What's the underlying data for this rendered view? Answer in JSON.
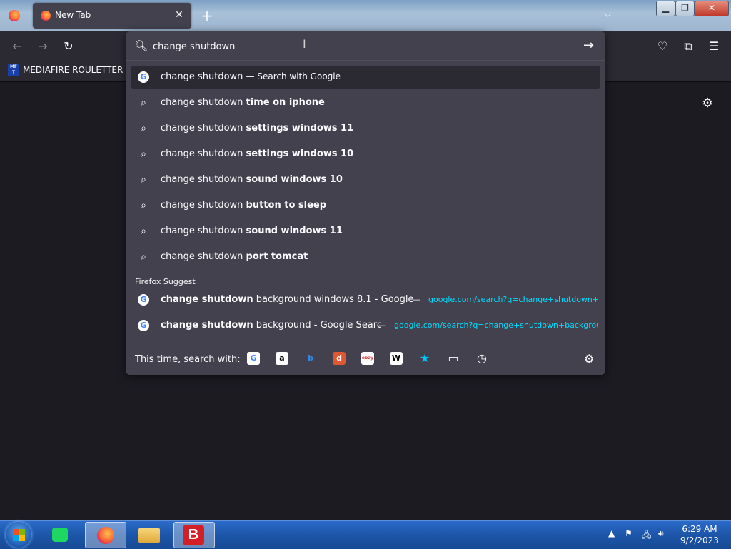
{
  "browser": {
    "tab_title": "New Tab",
    "tab_close": "✕",
    "new_tab": "+",
    "tab_list": "⌵",
    "window_min": "▁",
    "window_max": "❐",
    "window_close": "✕"
  },
  "navbar": {
    "back": "←",
    "forward": "→",
    "reload": "↻",
    "pocket": "♡",
    "extensions": "⧉",
    "menu": "☰"
  },
  "bookmarks": {
    "item_label": "MEDIAFIRE ROULETTER",
    "item_icon_text": "MF T"
  },
  "urlbar": {
    "value": "change shutdown",
    "go": "→"
  },
  "results": [
    {
      "prefix": "change shutdown",
      "bold": "",
      "action": "— Search with Google",
      "icon": "G"
    },
    {
      "prefix": "change shutdown",
      "bold": "time on iphone",
      "action": "",
      "icon": "search"
    },
    {
      "prefix": "change shutdown",
      "bold": "settings windows 11",
      "action": "",
      "icon": "search"
    },
    {
      "prefix": "change shutdown",
      "bold": "settings windows 10",
      "action": "",
      "icon": "search"
    },
    {
      "prefix": "change shutdown",
      "bold": "sound windows 10",
      "action": "",
      "icon": "search"
    },
    {
      "prefix": "change shutdown",
      "bold": "button to sleep",
      "action": "",
      "icon": "search"
    },
    {
      "prefix": "change shutdown",
      "bold": "sound windows 11",
      "action": "",
      "icon": "search"
    },
    {
      "prefix": "change shutdown",
      "bold": "port tomcat",
      "action": "",
      "icon": "search"
    }
  ],
  "suggest_section": "Firefox Suggest",
  "suggestions": [
    {
      "bold": "change shutdown",
      "rest": " background windows 8.1 - Google S",
      "sep": "—",
      "url": "google.com/search?q=change+shutdown+"
    },
    {
      "bold": "change shutdown",
      "rest": " background - Google Search",
      "sep": "—",
      "url": "google.com/search?q=change+shutdown+backgrou"
    }
  ],
  "oneoff": {
    "label": "This time, search with:",
    "engines": [
      "G",
      "a",
      "b",
      "d",
      "ebay",
      "W",
      "★",
      "▭",
      "◷"
    ]
  },
  "taskbar": {
    "time": "6:29 AM",
    "date": "9/2/2023"
  }
}
